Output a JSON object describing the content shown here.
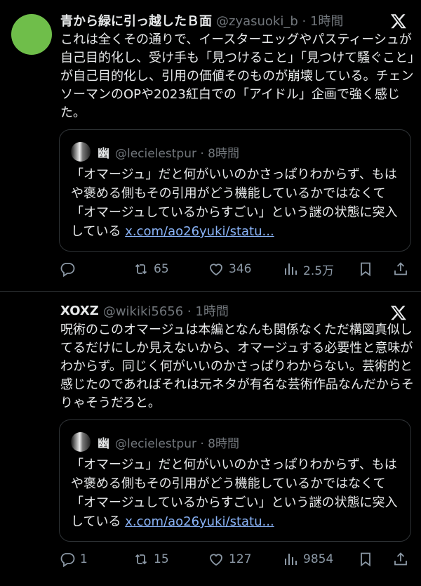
{
  "tweets": [
    {
      "author": "青から緑に引っ越したＢ面",
      "handle": "@zyasuoki_b · 1時間",
      "avatar_color": "#6fbe4a",
      "text": "これは全くその通りで、イースターエッグやパスティーシュが自己目的化し、受け手も「見つけること」「見つけて騒ぐこと」が自己目的化し、引用の価値そのものが崩壊している。チェンソーマンのOPや2023紅白での「アイドル」企画で強く感じた。",
      "quote": {
        "author": "幽",
        "handle": "@lecielestpur · 8時間",
        "text": "「オマージュ」だと何がいいのかさっぱりわからず、もはや褒める側もその引用がどう機能しているかではなくて「オマージュしているからすごい」という謎の状態に突入している ",
        "link": "x.com/ao26yuki/statu..."
      },
      "actions": {
        "replies": "",
        "retweets": "65",
        "likes": "346",
        "views": "2.5万"
      }
    },
    {
      "author": "XOXZ",
      "handle": "@wikiki5656 · 1時間",
      "text": "呪術のこのオマージュは本編となんも関係なくただ構図真似してるだけにしか見えないから、オマージュする必要性と意味がわからず。同じく何がいいのかさっぱりわからない。芸術的と感じたのであればそれは元ネタが有名な芸術作品なんだからそりゃそうだろと。",
      "quote": {
        "author": "幽",
        "handle": "@lecielestpur · 8時間",
        "text": "「オマージュ」だと何がいいのかさっぱりわからず、もはや褒める側もその引用がどう機能しているかではなくて「オマージュしているからすごい」という謎の状態に突入している ",
        "link": "x.com/ao26yuki/statu..."
      },
      "actions": {
        "replies": "1",
        "retweets": "15",
        "likes": "127",
        "views": "9854"
      }
    }
  ],
  "colors": {
    "background": "#000000",
    "text": "#e7e9ea",
    "muted": "#71767b",
    "link": "#8ab4f8",
    "border": "#2f3336"
  },
  "icons": [
    "x-logo-icon",
    "reply-icon",
    "retweet-icon",
    "like-icon",
    "views-icon",
    "bookmark-icon",
    "share-icon"
  ]
}
